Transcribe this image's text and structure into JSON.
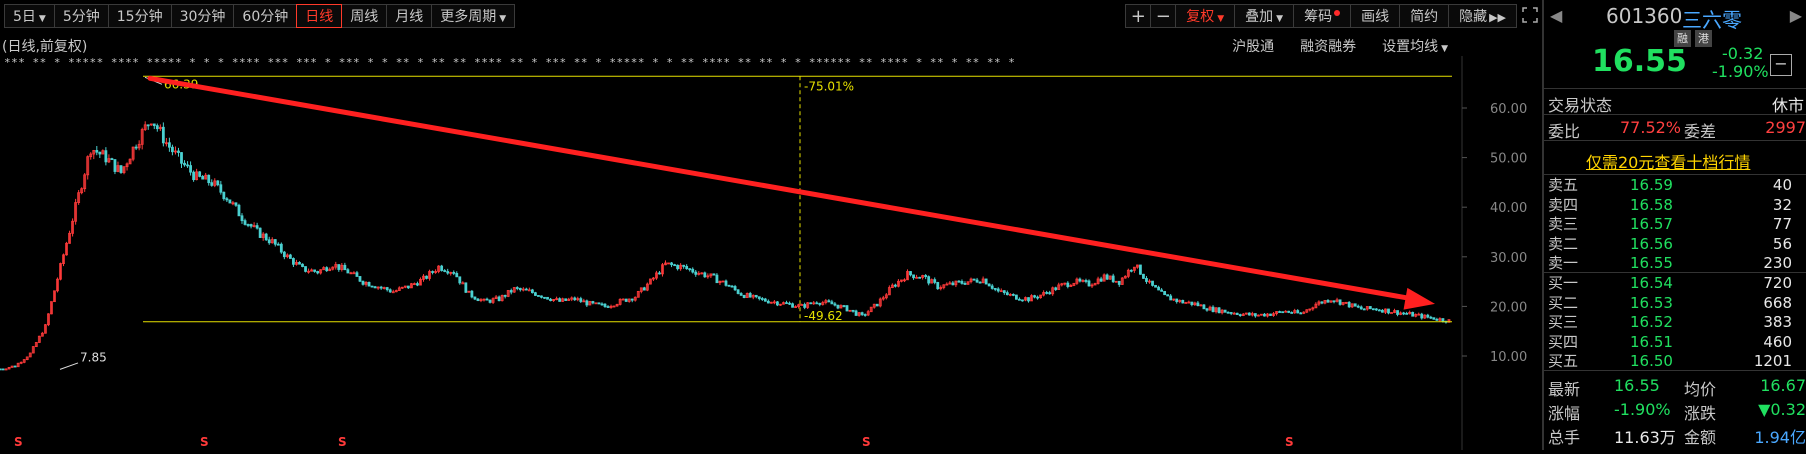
{
  "toolbar": {
    "periods": [
      {
        "label": "5日",
        "caret": true
      },
      {
        "label": "5分钟"
      },
      {
        "label": "15分钟"
      },
      {
        "label": "30分钟"
      },
      {
        "label": "60分钟"
      },
      {
        "label": "日线",
        "active": true
      },
      {
        "label": "周线"
      },
      {
        "label": "月线"
      },
      {
        "label": "更多周期",
        "caret": true
      }
    ],
    "right": {
      "plus": "+",
      "minus": "−",
      "fuquan": "复权",
      "overlay": "叠加",
      "chip": "筹码",
      "draw": "画线",
      "simple": "简约",
      "hide": "隐藏"
    }
  },
  "subheader": {
    "label": "(日线,前复权)",
    "links": [
      "沪股通",
      "融资融券",
      "设置均线"
    ]
  },
  "chart_data": {
    "type": "candlestick",
    "period": "日线",
    "adjust": "前复权",
    "y_ticks": [
      "60.00",
      "50.00",
      "40.00",
      "30.00",
      "20.00",
      "10.00"
    ],
    "ylim": [
      10,
      66.39
    ],
    "annotations": {
      "high_label": "66.39",
      "low_label": "7.85",
      "pct_up": "75.01%",
      "pct_down": "49.62",
      "upper_line": 66.39,
      "lower_line": 16.9
    },
    "series": [
      {
        "name": "K线",
        "close_path": [
          7.4,
          8.0,
          10.5,
          16.0,
          28.0,
          40.0,
          52.0,
          50.0,
          47.0,
          53.0,
          58.0,
          53.0,
          49.0,
          46.0,
          45.0,
          42.0,
          38.0,
          35.0,
          33.0,
          30.0,
          27.5,
          27.0,
          28.5,
          27.0,
          25.0,
          24.0,
          23.0,
          24.0,
          25.5,
          28.0,
          27.0,
          22.5,
          21.0,
          21.5,
          23.5,
          23.0,
          22.0,
          21.0,
          21.5,
          20.5,
          20.0,
          21.0,
          22.0,
          25.0,
          28.5,
          28.0,
          27.0,
          26.0,
          24.5,
          22.5,
          21.5,
          21.0,
          20.5,
          20.0,
          21.0,
          20.5,
          19.5,
          18.0,
          20.5,
          24.0,
          26.5,
          26.0,
          24.0,
          24.5,
          25.0,
          25.5,
          23.0,
          22.0,
          21.5,
          22.5,
          24.0,
          25.0,
          24.5,
          26.0,
          25.0,
          28.5,
          24.5,
          22.0,
          21.0,
          20.5,
          19.5,
          19.0,
          18.5,
          18.2,
          18.5,
          19.0,
          18.5,
          20.5,
          21.5,
          20.5,
          19.5,
          19.5,
          19.0,
          18.5,
          18.0,
          17.5,
          17.0
        ]
      }
    ]
  },
  "quote": {
    "code": "601360",
    "name": "三六零",
    "tag1": "融",
    "tag2": "港",
    "price": "16.55",
    "change": "-0.32",
    "change_pct": "-1.90%",
    "status_label": "交易状态",
    "status_value": "休市",
    "weibi_label": "委比",
    "weibi_value": "77.52%",
    "weicha_label": "委差",
    "weicha_value": "2997",
    "promo": "仅需20元查看十档行情",
    "asks": [
      {
        "label": "卖五",
        "price": "16.59",
        "vol": "40"
      },
      {
        "label": "卖四",
        "price": "16.58",
        "vol": "32"
      },
      {
        "label": "卖三",
        "price": "16.57",
        "vol": "77"
      },
      {
        "label": "卖二",
        "price": "16.56",
        "vol": "56"
      },
      {
        "label": "卖一",
        "price": "16.55",
        "vol": "230"
      }
    ],
    "bids": [
      {
        "label": "买一",
        "price": "16.54",
        "vol": "720"
      },
      {
        "label": "买二",
        "price": "16.53",
        "vol": "668"
      },
      {
        "label": "买三",
        "price": "16.52",
        "vol": "383"
      },
      {
        "label": "买四",
        "price": "16.51",
        "vol": "460"
      },
      {
        "label": "买五",
        "price": "16.50",
        "vol": "1201"
      }
    ],
    "stats": {
      "latest_label": "最新",
      "latest": "16.55",
      "avg_label": "均价",
      "avg": "16.67",
      "pct_label": "涨幅",
      "pct": "-1.90%",
      "chg_label": "涨跌",
      "chg": "▼0.32",
      "vol_label": "总手",
      "vol": "11.63万",
      "amt_label": "金额",
      "amt": "1.94亿"
    }
  }
}
